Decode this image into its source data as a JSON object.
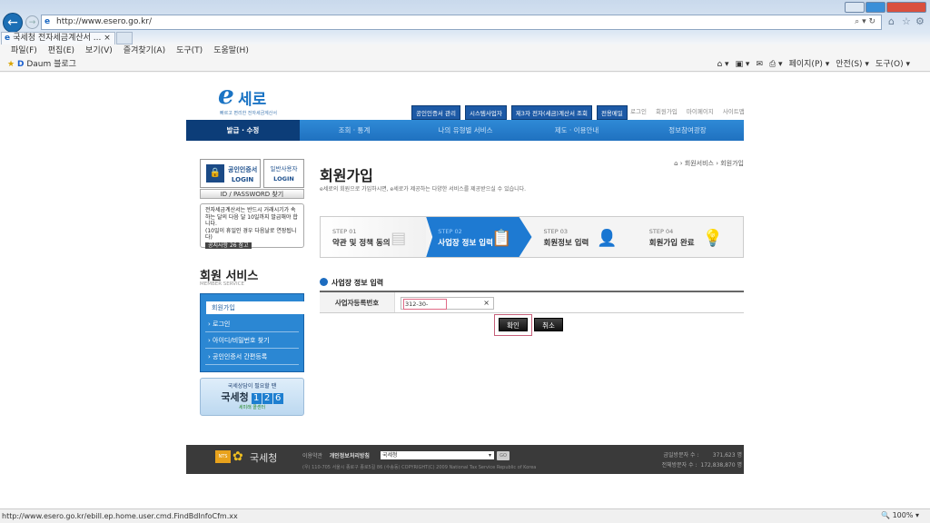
{
  "browser": {
    "url": "http://www.esero.go.kr/",
    "tab_title": "국세청 전자세금계산서 ...",
    "menu": [
      "파일(F)",
      "편집(E)",
      "보기(V)",
      "즐겨찾기(A)",
      "도구(T)",
      "도움말(H)"
    ],
    "favorite": "Daum 블로그",
    "commands": [
      "페이지(P) ▾",
      "안전(S) ▾",
      "도구(O) ▾"
    ],
    "status_url": "http://www.esero.go.kr/ebill.ep.home.user.cmd.FindBdInfoCfm.xx",
    "zoom": "100%"
  },
  "header": {
    "logo_text": "세로",
    "logo_sub": "빠르고 편리한 전자세금계산서",
    "top_buttons": [
      "공인인증서 관리",
      "시스템사업자",
      "제3자 전자(세금)계산서 조회",
      "전용메일"
    ],
    "top_links": [
      "로그인",
      "회원가입",
      "마이페이지",
      "사이트맵"
    ],
    "nav": [
      "발급 · 수정",
      "조회 · 통계",
      "나의 유형별 서비스",
      "제도 · 이용안내",
      "정보참여광장"
    ]
  },
  "sidebar": {
    "cert_login": [
      "공인인증서",
      "LOGIN"
    ],
    "general_login": [
      "일반사용자",
      "LOGIN"
    ],
    "idpw": "ID / PASSWORD 찾기",
    "notice": "전자세금계산서는 반드시 거래시기가 속하는 달의 다음 달 10일까지 발급해야 합니다.",
    "notice_note": "(10일이 휴일인 경우 다음날로 연장됩니다)",
    "notice_btn": "공지사항 26 참고",
    "service_title": "회원 서비스",
    "service_sub": "MEMBER SERVICE",
    "menu": [
      "회원가입",
      "로그인",
      "아이디/비밀번호 찾기",
      "공인인증서 간편등록"
    ],
    "banner_top": "국세상담이 필요할 땐",
    "banner_name": "국세청",
    "banner_digits": [
      "1",
      "2",
      "6"
    ],
    "banner_bottom": "세미래 콜센터"
  },
  "main": {
    "breadcrumb": [
      "⌂",
      "회원서비스",
      "회원가입"
    ],
    "title": "회원가입",
    "desc": "e세로의 회원으로 가입하시면, e세로가 제공하는 다양한 서비스를 제공받으실 수 있습니다.",
    "steps": [
      {
        "num": "STEP 01",
        "label": "약관 및 정책 동의"
      },
      {
        "num": "STEP 02",
        "label": "사업장 정보 입력"
      },
      {
        "num": "STEP 03",
        "label": "회원정보 입력"
      },
      {
        "num": "STEP 04",
        "label": "회원가입 완료"
      }
    ],
    "active_step": 2,
    "section": "사업장 정보 입력",
    "field_label": "사업자등록번호",
    "field_value": "312-30-",
    "ok": "확인",
    "cancel": "취소"
  },
  "footer": {
    "org": "국세청",
    "nts": "NTS",
    "terms": "이용약관",
    "privacy": "개인정보처리방침",
    "select_value": "국세청",
    "go": "GO",
    "address": "(우) 110-705 서울시 종로구 종로5길 86 (수송동)   COPYRIGHT(C) 2009 National Tax Service Republic of Korea",
    "today_label": "금일방문자 수 :",
    "today": "371,623 명",
    "total_label": "전체방문자 수 :",
    "total": "172,838,870 명"
  }
}
